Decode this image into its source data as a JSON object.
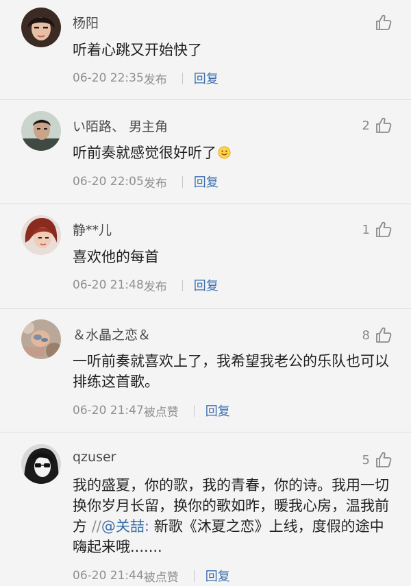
{
  "comments": [
    {
      "user": "杨阳",
      "likes": "",
      "text": "听着心跳又开始快了",
      "time": "06-20 22:35",
      "status": "发布",
      "reply": "回复",
      "avatar": "avatar-photo-woman"
    },
    {
      "user": "い陌路、 男主角",
      "likes": "2",
      "text": "听前奏就感觉很好听了",
      "emoji": "smile-emoji-icon",
      "time": "06-20 22:05",
      "status": "发布",
      "reply": "回复",
      "avatar": "avatar-photo-man"
    },
    {
      "user": "静**儿",
      "likes": "1",
      "text": "喜欢他的每首",
      "time": "06-20 21:48",
      "status": "发布",
      "reply": "回复",
      "avatar": "avatar-photo-redhair"
    },
    {
      "user": "＆水晶之恋＆",
      "likes": "8",
      "text": "一听前奏就喜欢上了，我希望我老公的乐队也可以排练这首歌。",
      "time": "06-20 21:47",
      "status": "被点赞",
      "reply": "回复",
      "avatar": "avatar-photo-baby"
    },
    {
      "user": "qzuser",
      "likes": "5",
      "text": "我的盛夏，你的歌，我的青春，你的诗。我用一切换你岁月长留，换你的歌如昨，暖我心房，温我前方 ",
      "quote_prefix": "//",
      "mention": "@关喆:",
      "quote_text": " 新歌《沐夏之恋》上线，度假的途中嗨起来哦.......",
      "time": "06-20 21:44",
      "status": "被点赞",
      "reply": "回复",
      "avatar": "avatar-photo-sunglasses"
    }
  ],
  "icons": {
    "like": "thumbs-up-icon"
  },
  "colors": {
    "background": "#f4f4f4",
    "reply_link": "#3d6fb0",
    "meta_text": "#8f8f8f",
    "divider": "#dcdcdc"
  }
}
